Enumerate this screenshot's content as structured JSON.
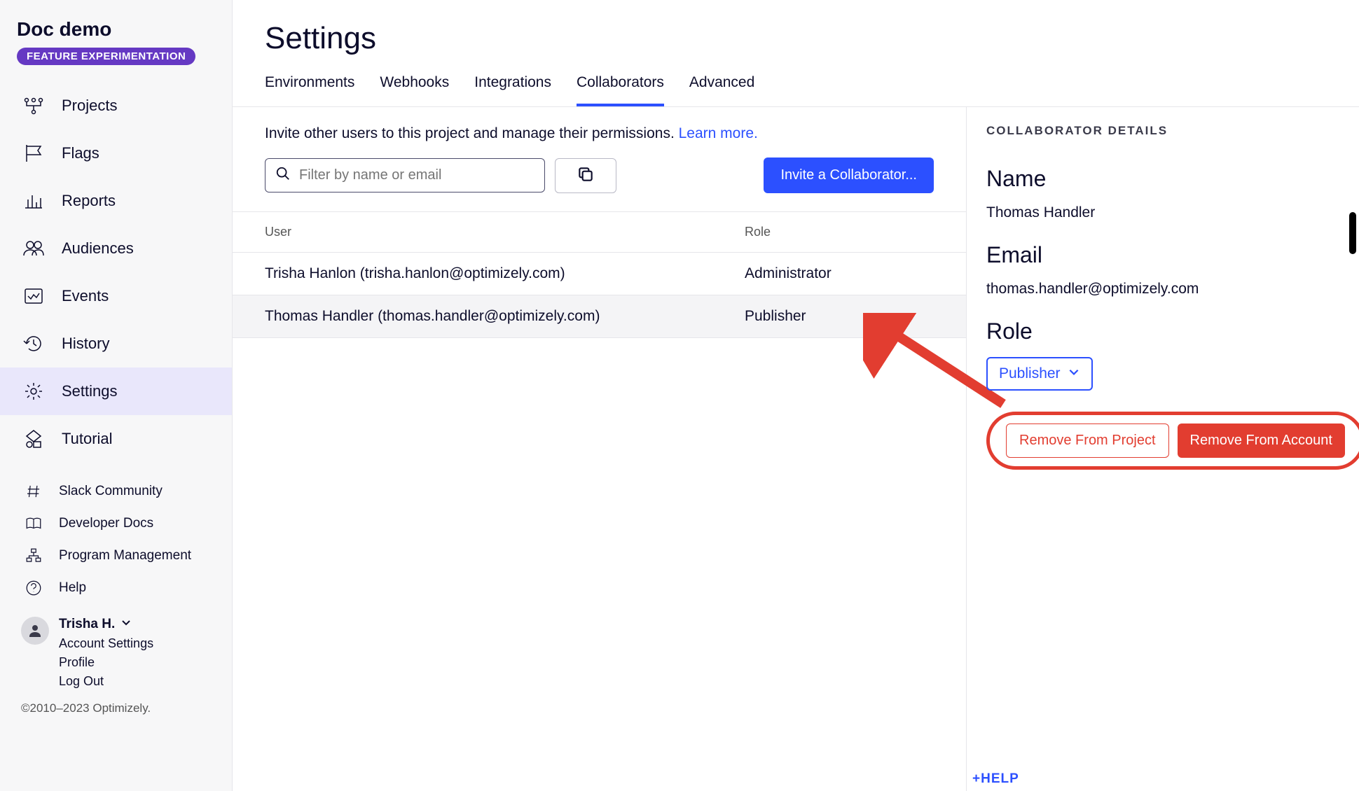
{
  "sidebar": {
    "project_title": "Doc demo",
    "badge": "FEATURE EXPERIMENTATION",
    "nav": [
      {
        "label": "Projects",
        "icon": "projects"
      },
      {
        "label": "Flags",
        "icon": "flag"
      },
      {
        "label": "Reports",
        "icon": "reports"
      },
      {
        "label": "Audiences",
        "icon": "audiences"
      },
      {
        "label": "Events",
        "icon": "events"
      },
      {
        "label": "History",
        "icon": "history"
      },
      {
        "label": "Settings",
        "icon": "settings",
        "active": true
      },
      {
        "label": "Tutorial",
        "icon": "tutorial"
      }
    ],
    "links": [
      {
        "label": "Slack Community",
        "icon": "hash"
      },
      {
        "label": "Developer Docs",
        "icon": "book"
      },
      {
        "label": "Program Management",
        "icon": "org"
      },
      {
        "label": "Help",
        "icon": "help"
      }
    ],
    "user": {
      "name": "Trisha H.",
      "links": [
        "Account Settings",
        "Profile",
        "Log Out"
      ]
    },
    "copyright": "©2010–2023 Optimizely."
  },
  "page": {
    "title": "Settings",
    "tabs": [
      "Environments",
      "Webhooks",
      "Integrations",
      "Collaborators",
      "Advanced"
    ],
    "active_tab": "Collaborators"
  },
  "collaborators": {
    "intro_text": "Invite other users to this project and manage their permissions. ",
    "learn_more": "Learn more.",
    "filter_placeholder": "Filter by name or email",
    "invite_button": "Invite a Collaborator...",
    "columns": {
      "user": "User",
      "role": "Role"
    },
    "rows": [
      {
        "user": "Trisha Hanlon (trisha.hanlon@optimizely.com)",
        "role": "Administrator",
        "selected": false
      },
      {
        "user": "Thomas Handler (thomas.handler@optimizely.com)",
        "role": "Publisher",
        "selected": true
      }
    ]
  },
  "details": {
    "heading": "COLLABORATOR DETAILS",
    "name_label": "Name",
    "name_value": "Thomas Handler",
    "email_label": "Email",
    "email_value": "thomas.handler@optimizely.com",
    "role_label": "Role",
    "role_value": "Publisher",
    "remove_project": "Remove From Project",
    "remove_account": "Remove From Account"
  },
  "help_link": "+HELP"
}
